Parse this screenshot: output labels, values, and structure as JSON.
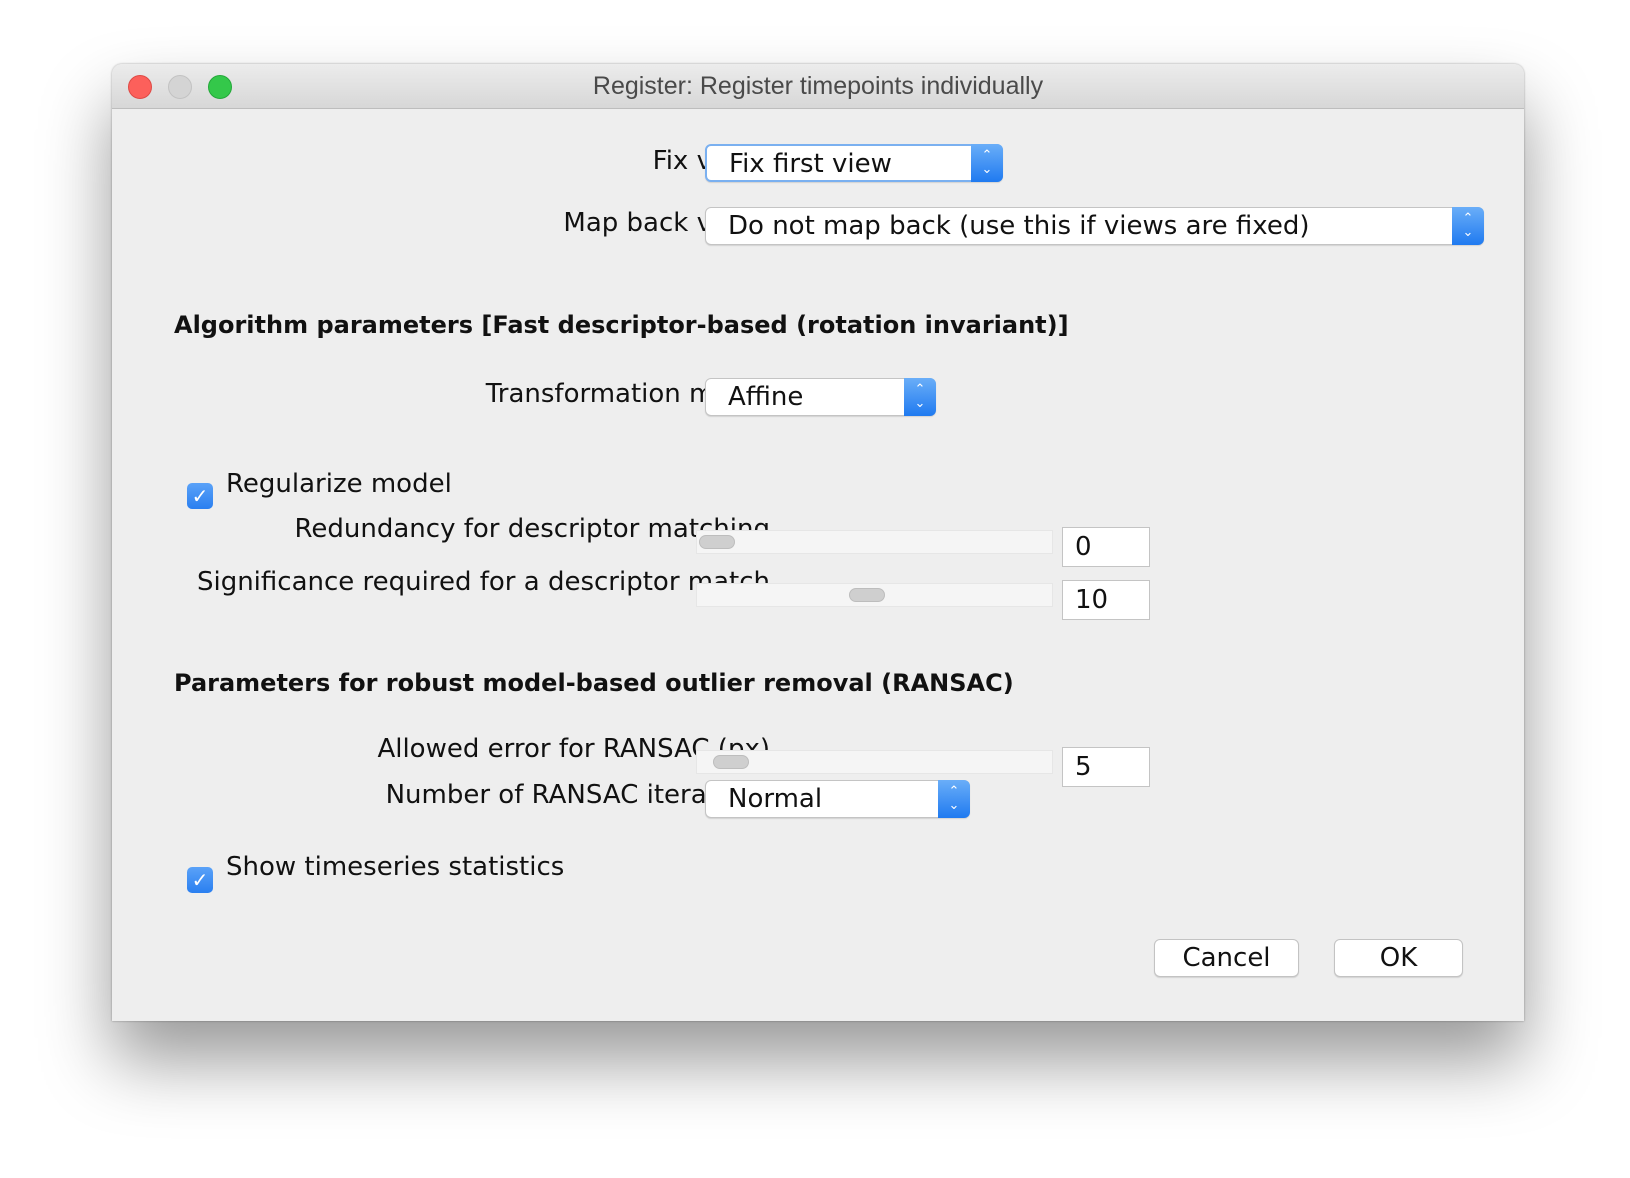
{
  "window": {
    "title": "Register: Register timepoints individually"
  },
  "fix_views": {
    "label": "Fix views",
    "selected": "Fix first view"
  },
  "map_back_views": {
    "label": "Map back views",
    "selected": "Do not map back (use this if views are fixed)"
  },
  "algorithm_section": {
    "heading": "Algorithm parameters [Fast descriptor-based (rotation invariant)]"
  },
  "transformation_model": {
    "label": "Transformation model",
    "selected": "Affine"
  },
  "regularize_model": {
    "label": "Regularize model",
    "checked": true
  },
  "redundancy": {
    "label": "Redundancy for descriptor matching",
    "value": "0"
  },
  "significance": {
    "label": "Significance required for a descriptor match",
    "value": "10"
  },
  "ransac_section": {
    "heading": "Parameters for robust model-based outlier removal (RANSAC)"
  },
  "allowed_error": {
    "label": "Allowed error for RANSAC (px)",
    "value": "5"
  },
  "ransac_iterations": {
    "label": "Number of RANSAC iterations",
    "selected": "Normal"
  },
  "show_stats": {
    "label": "Show timeseries statistics",
    "checked": true
  },
  "buttons": {
    "cancel": "Cancel",
    "ok": "OK"
  },
  "colors": {
    "accent": "#2a7ff0",
    "close": "#fc605b",
    "maximize": "#34c84a",
    "window_bg": "#eeeeee"
  }
}
